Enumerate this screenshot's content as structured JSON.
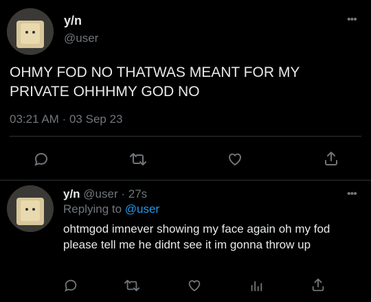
{
  "tweet": {
    "name": "y/n",
    "handle": "@user",
    "text": "OHMY FOD NO THATWAS MEANT FOR MY PRIVATE OHHHMY GOD NO",
    "time": "03:21 AM",
    "separator": "·",
    "date": "03 Sep 23",
    "more": "•••",
    "actions": [
      "reply-icon",
      "retweet-icon",
      "like-icon",
      "share-icon"
    ]
  },
  "reply": {
    "name": "y/n",
    "handle": "@user",
    "separator": "·",
    "age": "27s",
    "replying_prefix": "Replying to",
    "replying_to": "@user",
    "text": "ohtmgod imnever showing my face again oh my fod please tell me he didnt see it im gonna throw up",
    "more": "•••",
    "actions": [
      "reply-icon",
      "retweet-icon",
      "like-icon",
      "views-icon",
      "share-icon"
    ]
  },
  "colors": {
    "background": "#000000",
    "text": "#e7e9ea",
    "muted": "#71767b",
    "link": "#1d9bf0",
    "divider": "#2f3336"
  }
}
